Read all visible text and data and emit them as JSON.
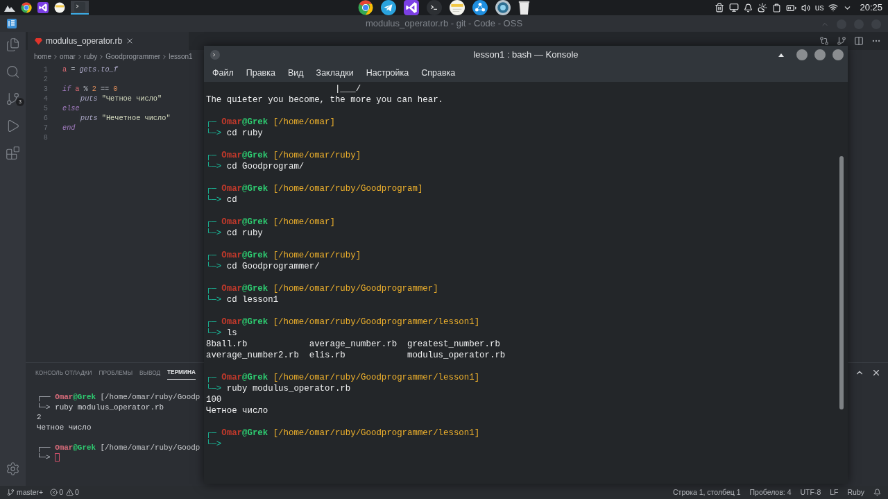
{
  "taskbar": {
    "keyboard_layout": "us",
    "clock": "20:25"
  },
  "code_window": {
    "title": "modulus_operator.rb - git - Code - OSS",
    "scm_badge": "3",
    "tab": {
      "label": "modulus_operator.rb"
    },
    "breadcrumb": [
      "home",
      "omar",
      "ruby",
      "Goodprogrammer",
      "lesson1"
    ],
    "lines": [
      {
        "number": "1",
        "indented": false,
        "tokens": [
          {
            "kind": "variable",
            "text": "a"
          },
          {
            "kind": "operator",
            "text": "="
          },
          {
            "kind": "method",
            "text": "gets.to_f"
          }
        ]
      },
      {
        "number": "2"
      },
      {
        "number": "3",
        "indented": false,
        "tokens": [
          {
            "kind": "keyword",
            "text": "if"
          },
          {
            "kind": "variable",
            "text": "a"
          },
          {
            "kind": "operator",
            "text": "%"
          },
          {
            "kind": "number",
            "text": "2"
          },
          {
            "kind": "operator",
            "text": "=="
          },
          {
            "kind": "number",
            "text": "0"
          }
        ]
      },
      {
        "number": "4",
        "indented": true,
        "tokens": [
          {
            "kind": "method",
            "text": "puts"
          },
          {
            "kind": "string",
            "text": "\"Четное число\""
          }
        ]
      },
      {
        "number": "5",
        "indented": false,
        "tokens": [
          {
            "kind": "keyword",
            "text": "else"
          }
        ]
      },
      {
        "number": "6",
        "indented": true,
        "tokens": [
          {
            "kind": "method",
            "text": "puts"
          },
          {
            "kind": "string",
            "text": "\"Нечетное число\""
          }
        ]
      },
      {
        "number": "7",
        "indented": false,
        "tokens": [
          {
            "kind": "keyword",
            "text": "end"
          }
        ]
      },
      {
        "number": "8"
      }
    ]
  },
  "panel": {
    "tabs": [
      {
        "label": "КОНСОЛЬ ОТЛАДКИ",
        "selected": false
      },
      {
        "label": "ПРОБЛЕМЫ",
        "selected": false
      },
      {
        "label": "ВЫВОД",
        "selected": false
      },
      {
        "label": "ТЕРМИНА",
        "selected": true
      }
    ],
    "lines": [
      {
        "kind": "prompt",
        "corner": "┌──",
        "user": "Omar",
        "separator": "@",
        "host": "Grek",
        "path": "[/home/omar/ruby/Goodp"
      },
      {
        "kind": "command",
        "arrow": "└─>",
        "text": "ruby modulus_operator.rb"
      },
      {
        "kind": "output",
        "text": "2"
      },
      {
        "kind": "output",
        "text": "Четное число"
      },
      {
        "kind": "blank"
      },
      {
        "kind": "prompt",
        "corner": "┌──",
        "user": "Omar",
        "separator": "@",
        "host": "Grek",
        "path": "[/home/omar/ruby/Goodp"
      },
      {
        "kind": "cursor",
        "arrow": "└─>"
      }
    ]
  },
  "status_bar": {
    "branch": "master+",
    "errors": "0",
    "warnings": "0",
    "items": [
      "Строка 1, столбец 1",
      "Пробелов: 4",
      "UTF-8",
      "LF",
      "Ruby"
    ]
  },
  "konsole": {
    "title": "lesson1 : bash — Konsole",
    "menu": [
      "Файл",
      "Правка",
      "Вид",
      "Закладки",
      "Настройка",
      "Справка"
    ],
    "lines": [
      {
        "kind": "output",
        "text": "                         |___/"
      },
      {
        "kind": "output",
        "text": "The quieter you become, the more you can hear."
      },
      {
        "kind": "blank"
      },
      {
        "kind": "prompt",
        "corner": "┌─",
        "user": "Omar",
        "separator": "@",
        "host": "Grek",
        "path": "[/home/omar]"
      },
      {
        "kind": "command",
        "arrow": "└─>",
        "text": "cd ruby"
      },
      {
        "kind": "blank"
      },
      {
        "kind": "prompt",
        "corner": "┌─",
        "user": "Omar",
        "separator": "@",
        "host": "Grek",
        "path": "[/home/omar/ruby]"
      },
      {
        "kind": "command",
        "arrow": "└─>",
        "text": "cd Goodprogram/"
      },
      {
        "kind": "blank"
      },
      {
        "kind": "prompt",
        "corner": "┌─",
        "user": "Omar",
        "separator": "@",
        "host": "Grek",
        "path": "[/home/omar/ruby/Goodprogram]"
      },
      {
        "kind": "command",
        "arrow": "└─>",
        "text": "cd"
      },
      {
        "kind": "blank"
      },
      {
        "kind": "prompt",
        "corner": "┌─",
        "user": "Omar",
        "separator": "@",
        "host": "Grek",
        "path": "[/home/omar]"
      },
      {
        "kind": "command",
        "arrow": "└─>",
        "text": "cd ruby"
      },
      {
        "kind": "blank"
      },
      {
        "kind": "prompt",
        "corner": "┌─",
        "user": "Omar",
        "separator": "@",
        "host": "Grek",
        "path": "[/home/omar/ruby]"
      },
      {
        "kind": "command",
        "arrow": "└─>",
        "text": "cd Goodprogrammer/"
      },
      {
        "kind": "blank"
      },
      {
        "kind": "prompt",
        "corner": "┌─",
        "user": "Omar",
        "separator": "@",
        "host": "Grek",
        "path": "[/home/omar/ruby/Goodprogrammer]"
      },
      {
        "kind": "command",
        "arrow": "└─>",
        "text": "cd lesson1"
      },
      {
        "kind": "blank"
      },
      {
        "kind": "prompt",
        "corner": "┌─",
        "user": "Omar",
        "separator": "@",
        "host": "Grek",
        "path": "[/home/omar/ruby/Goodprogrammer/lesson1]"
      },
      {
        "kind": "command",
        "arrow": "└─>",
        "text": "ls"
      },
      {
        "kind": "output",
        "text": "8ball.rb            average_number.rb  greatest_number.rb"
      },
      {
        "kind": "output",
        "text": "average_number2.rb  elis.rb            modulus_operator.rb"
      },
      {
        "kind": "blank"
      },
      {
        "kind": "prompt",
        "corner": "┌─",
        "user": "Omar",
        "separator": "@",
        "host": "Grek",
        "path": "[/home/omar/ruby/Goodprogrammer/lesson1]"
      },
      {
        "kind": "command",
        "arrow": "└─>",
        "text": "ruby modulus_operator.rb"
      },
      {
        "kind": "output",
        "text": "100"
      },
      {
        "kind": "output",
        "text": "Четное число"
      },
      {
        "kind": "blank"
      },
      {
        "kind": "prompt",
        "corner": "┌─",
        "user": "Omar",
        "separator": "@",
        "host": "Grek",
        "path": "[/home/omar/ruby/Goodprogrammer/lesson1]"
      },
      {
        "kind": "command",
        "arrow": "└─>"
      }
    ]
  }
}
